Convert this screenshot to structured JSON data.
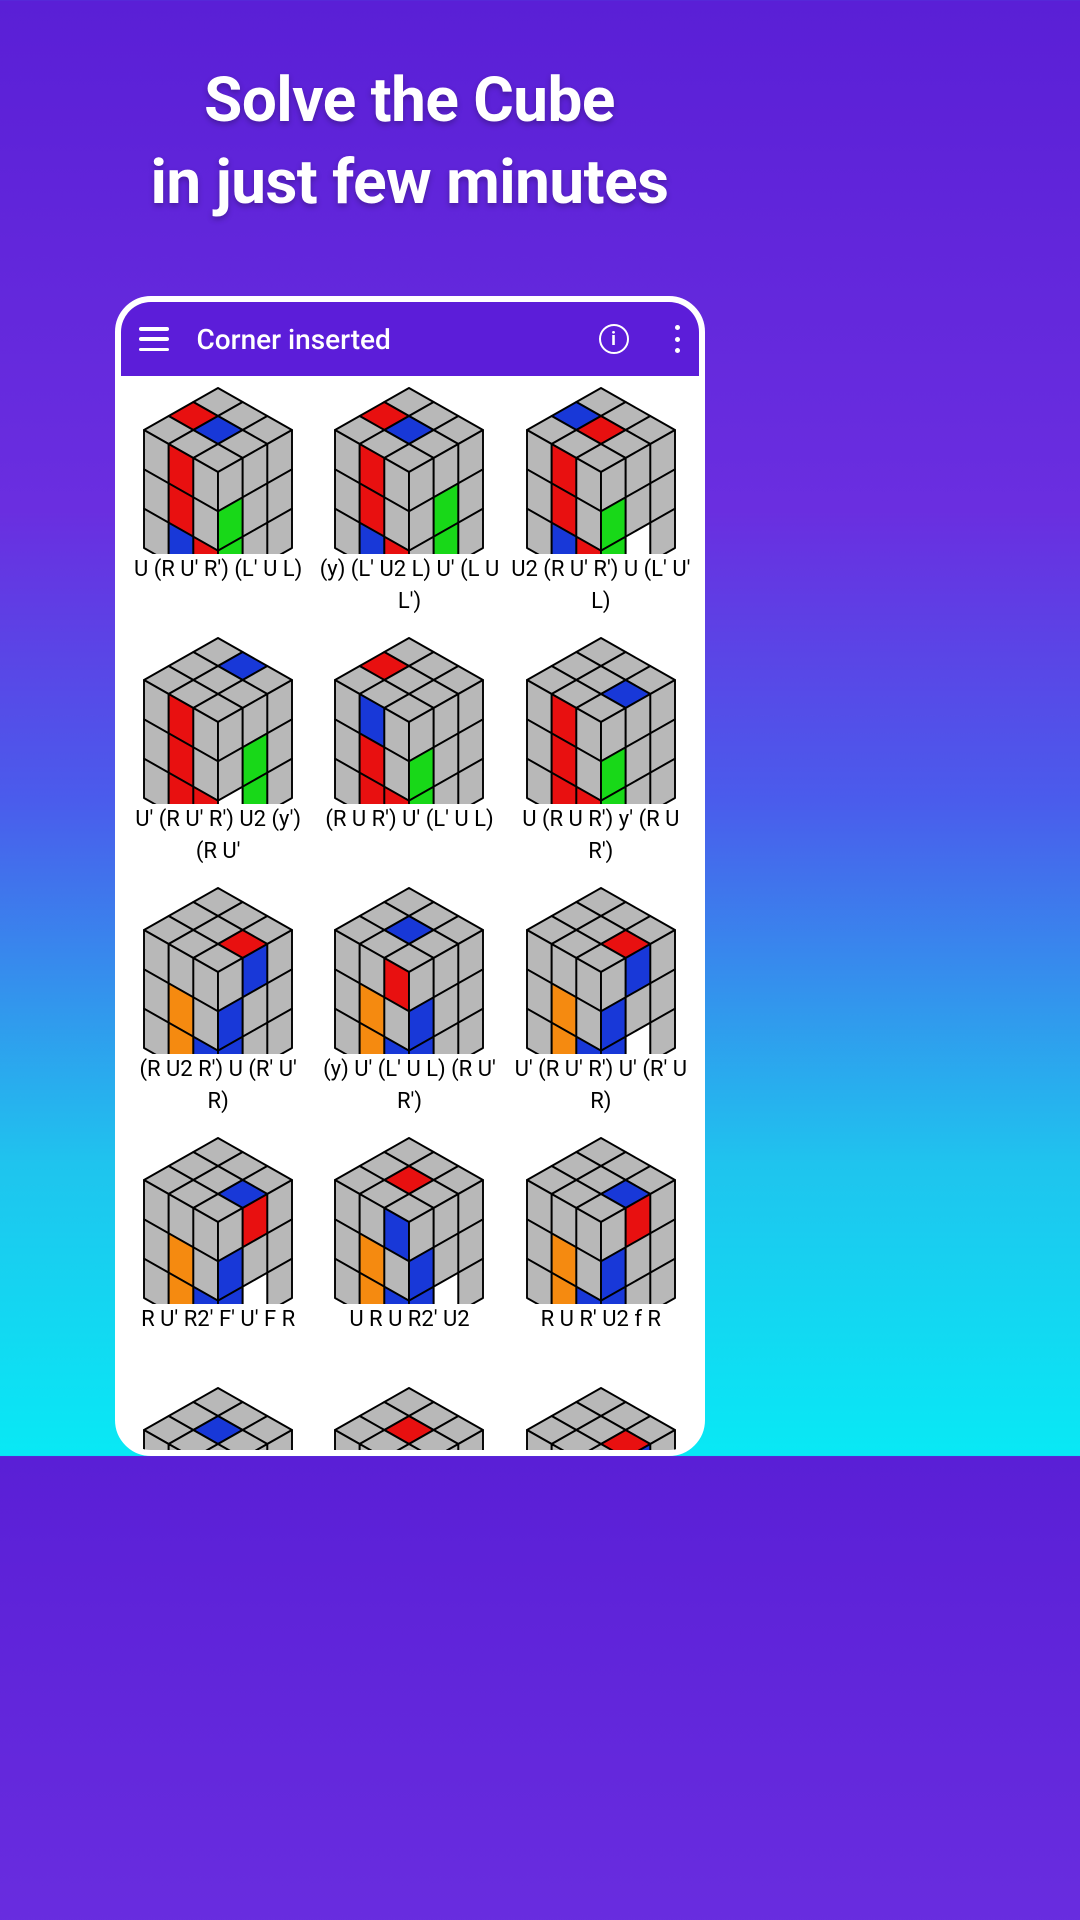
{
  "promo": {
    "line1": "Solve the Cube",
    "line2": "in just few minutes"
  },
  "appBar": {
    "title": "Corner inserted"
  },
  "colors": {
    "accent": "#5c1dd9",
    "grey": "#b8b8b8",
    "red": "#e81010",
    "blue": "#1838d8",
    "orange": "#f58a10",
    "white": "#ffffff",
    "green": "#18d818"
  },
  "cubes": [
    {
      "alg": "U (R U' R') (L' U L)",
      "top": [
        "g",
        "g",
        "g",
        "r",
        "b",
        "g",
        "g",
        "g",
        "g"
      ],
      "left": [
        "g",
        "r",
        "g",
        "g",
        "r",
        "g",
        "g",
        "b",
        "r"
      ],
      "right": [
        "g",
        "g",
        "g",
        "gr",
        "g",
        "g",
        "gr",
        "g",
        "g"
      ]
    },
    {
      "alg": "(y) (L' U2 L) U' (L U L')",
      "top": [
        "g",
        "g",
        "g",
        "r",
        "b",
        "g",
        "g",
        "g",
        "g"
      ],
      "left": [
        "g",
        "r",
        "g",
        "g",
        "r",
        "g",
        "g",
        "b",
        "r"
      ],
      "right": [
        "g",
        "g",
        "g",
        "g",
        "gr",
        "g",
        "g",
        "gr",
        "g"
      ]
    },
    {
      "alg": "U2 (R U' R') U (L' U' L)",
      "top": [
        "g",
        "g",
        "g",
        "b",
        "r",
        "g",
        "g",
        "g",
        "g"
      ],
      "left": [
        "g",
        "r",
        "g",
        "g",
        "r",
        "g",
        "g",
        "b",
        "r"
      ],
      "right": [
        "g",
        "g",
        "g",
        "gr",
        "g",
        "g",
        "gr",
        "w",
        "g"
      ]
    },
    {
      "alg": "U' (R U' R') U2 (y') (R U'",
      "top": [
        "g",
        "b",
        "g",
        "g",
        "g",
        "g",
        "g",
        "g",
        "g"
      ],
      "left": [
        "g",
        "r",
        "g",
        "g",
        "r",
        "g",
        "g",
        "r",
        "r"
      ],
      "right": [
        "g",
        "g",
        "g",
        "g",
        "gr",
        "g",
        "w",
        "gr",
        "g"
      ]
    },
    {
      "alg": "(R U R') U' (L' U L)",
      "top": [
        "g",
        "g",
        "g",
        "r",
        "g",
        "g",
        "g",
        "g",
        "g"
      ],
      "left": [
        "g",
        "b",
        "g",
        "g",
        "r",
        "g",
        "g",
        "r",
        "r"
      ],
      "right": [
        "g",
        "g",
        "g",
        "gr",
        "g",
        "g",
        "gr",
        "g",
        "g"
      ]
    },
    {
      "alg": "U (R U R') y' (R U R')",
      "top": [
        "g",
        "g",
        "g",
        "g",
        "g",
        "b",
        "g",
        "g",
        "g"
      ],
      "left": [
        "g",
        "r",
        "g",
        "g",
        "r",
        "g",
        "g",
        "r",
        "r"
      ],
      "right": [
        "g",
        "g",
        "g",
        "gr",
        "g",
        "g",
        "gr",
        "g",
        "g"
      ]
    },
    {
      "alg": "(R U2 R') U (R' U' R)",
      "top": [
        "g",
        "g",
        "g",
        "g",
        "g",
        "r",
        "g",
        "g",
        "g"
      ],
      "left": [
        "g",
        "g",
        "g",
        "g",
        "o",
        "g",
        "g",
        "o",
        "b"
      ],
      "right": [
        "g",
        "b",
        "g",
        "b",
        "g",
        "g",
        "b",
        "g",
        "g"
      ]
    },
    {
      "alg": "(y) U' (L' U L) (R U' R')",
      "top": [
        "g",
        "g",
        "g",
        "g",
        "b",
        "g",
        "g",
        "g",
        "g"
      ],
      "left": [
        "g",
        "g",
        "r",
        "g",
        "o",
        "g",
        "g",
        "o",
        "b"
      ],
      "right": [
        "g",
        "g",
        "g",
        "b",
        "g",
        "g",
        "b",
        "g",
        "g"
      ]
    },
    {
      "alg": "U' (R U' R') U' (R' U R)",
      "top": [
        "g",
        "g",
        "g",
        "g",
        "g",
        "r",
        "g",
        "g",
        "g"
      ],
      "left": [
        "g",
        "g",
        "g",
        "g",
        "o",
        "g",
        "g",
        "o",
        "b"
      ],
      "right": [
        "g",
        "b",
        "g",
        "b",
        "g",
        "g",
        "b",
        "w",
        "g"
      ]
    },
    {
      "alg": "R U' R2' F' U' F R",
      "top": [
        "g",
        "g",
        "g",
        "g",
        "g",
        "b",
        "g",
        "g",
        "g"
      ],
      "left": [
        "g",
        "g",
        "g",
        "g",
        "o",
        "g",
        "g",
        "o",
        "b"
      ],
      "right": [
        "g",
        "r",
        "g",
        "b",
        "g",
        "g",
        "b",
        "w",
        "g"
      ]
    },
    {
      "alg": "U R U R2' U2",
      "top": [
        "g",
        "g",
        "g",
        "g",
        "r",
        "g",
        "g",
        "g",
        "g"
      ],
      "left": [
        "g",
        "g",
        "b",
        "g",
        "o",
        "g",
        "g",
        "o",
        "b"
      ],
      "right": [
        "g",
        "g",
        "g",
        "b",
        "g",
        "g",
        "b",
        "w",
        "g"
      ]
    },
    {
      "alg": "R U R' U2 f R",
      "top": [
        "g",
        "g",
        "g",
        "g",
        "g",
        "b",
        "g",
        "g",
        "g"
      ],
      "left": [
        "g",
        "g",
        "g",
        "g",
        "o",
        "g",
        "g",
        "o",
        "b"
      ],
      "right": [
        "g",
        "r",
        "g",
        "b",
        "g",
        "g",
        "b",
        "g",
        "g"
      ]
    },
    {
      "alg": "",
      "top": [
        "g",
        "g",
        "g",
        "g",
        "b",
        "g",
        "g",
        "g",
        "g"
      ],
      "left": [
        "g",
        "g",
        "r",
        "g",
        "o",
        "g",
        "g",
        "o",
        "b"
      ],
      "right": [
        "g",
        "g",
        "g",
        "b",
        "g",
        "g",
        "b",
        "g",
        "g"
      ]
    },
    {
      "alg": "",
      "top": [
        "g",
        "g",
        "g",
        "g",
        "r",
        "g",
        "g",
        "g",
        "g"
      ],
      "left": [
        "g",
        "g",
        "b",
        "g",
        "o",
        "g",
        "g",
        "o",
        "b"
      ],
      "right": [
        "g",
        "g",
        "g",
        "b",
        "g",
        "g",
        "b",
        "g",
        "g"
      ]
    },
    {
      "alg": "",
      "top": [
        "g",
        "g",
        "g",
        "g",
        "g",
        "r",
        "g",
        "g",
        "g"
      ],
      "left": [
        "g",
        "g",
        "g",
        "g",
        "o",
        "g",
        "g",
        "o",
        "b"
      ],
      "right": [
        "g",
        "b",
        "g",
        "b",
        "g",
        "g",
        "b",
        "g",
        "g"
      ]
    }
  ]
}
